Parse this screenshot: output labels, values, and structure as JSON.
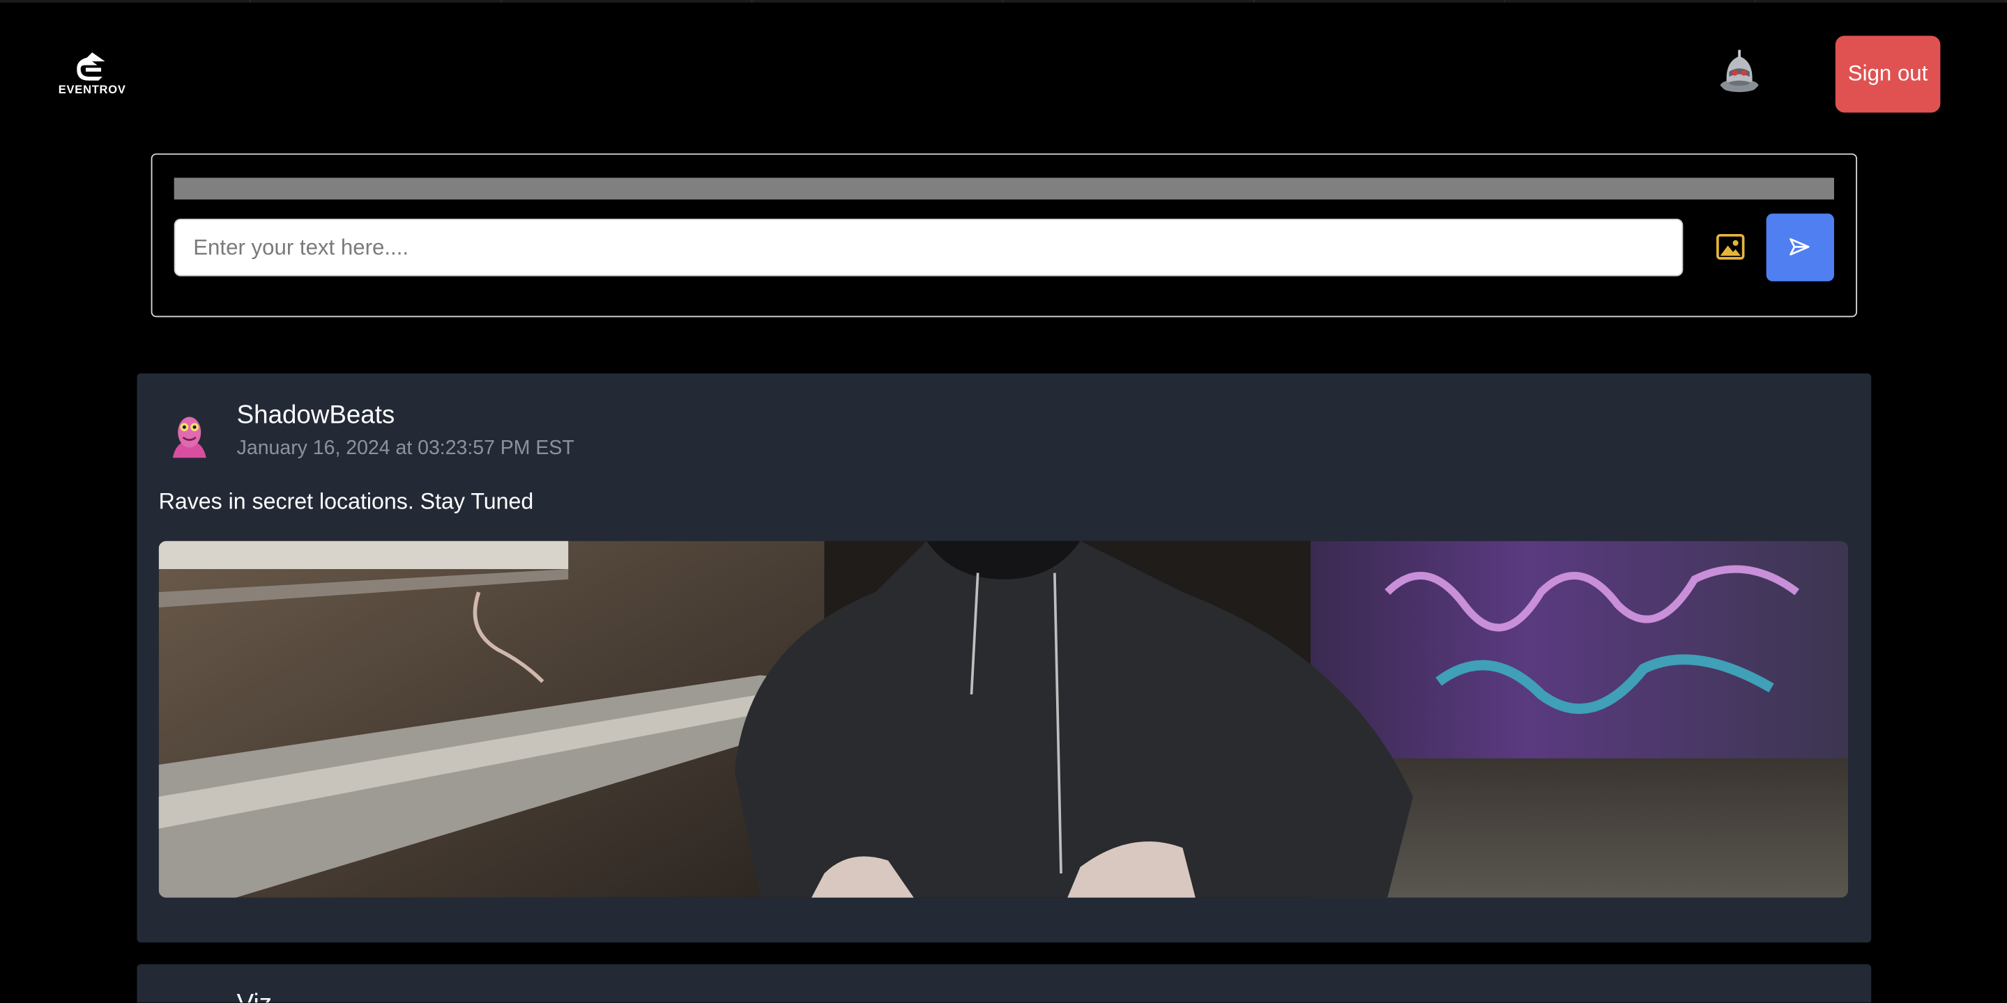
{
  "header": {
    "logo_text": "EVENTROV",
    "logo_icon": "eventrov-logo-icon",
    "avatar_icon": "robot-avatar-icon",
    "signout_label": "Sign out",
    "signout_color": "#e05252"
  },
  "composer": {
    "placeholder": "Enter your text here....",
    "image_icon": "image-upload-icon",
    "send_icon": "send-icon",
    "send_color": "#4f7ff0"
  },
  "posts": [
    {
      "username": "ShadowBeats",
      "timestamp": "January 16, 2024 at 03:23:57 PM EST",
      "text": "Raves in secret locations. Stay Tuned",
      "avatar_icon": "pink-creature-avatar-icon"
    },
    {
      "username": "Viz"
    }
  ]
}
